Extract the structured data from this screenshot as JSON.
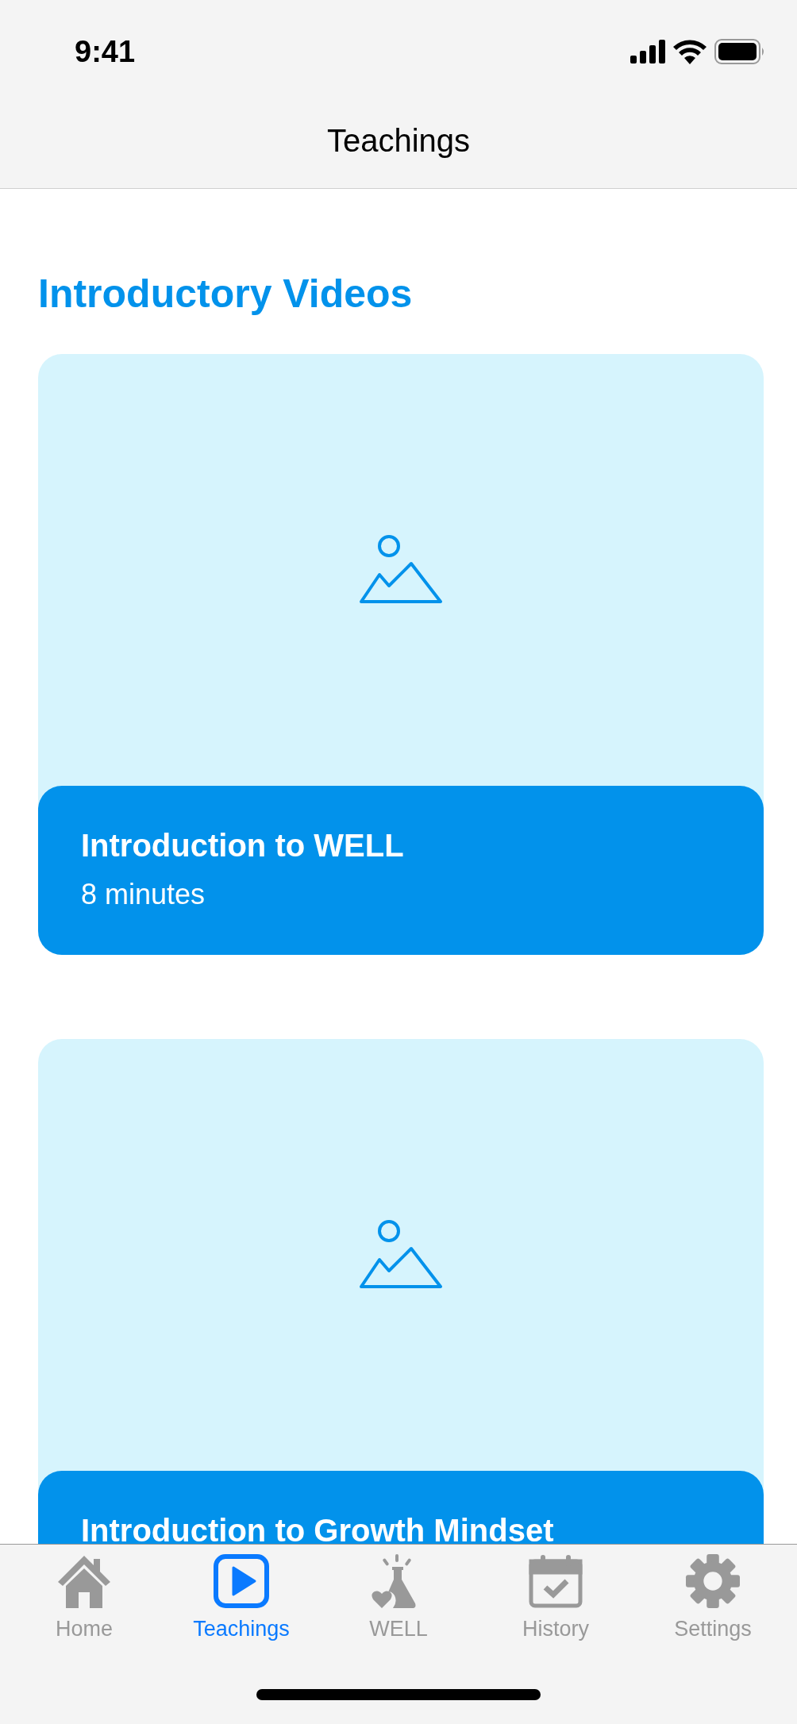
{
  "status_bar": {
    "time": "9:41"
  },
  "nav_bar": {
    "title": "Teachings"
  },
  "section": {
    "title": "Introductory Videos"
  },
  "videos": [
    {
      "title": "Introduction to WELL",
      "duration": "8 minutes"
    },
    {
      "title": "Introduction to Growth Mindset"
    }
  ],
  "tab_bar": [
    {
      "label": "Home",
      "selected": false
    },
    {
      "label": "Teachings",
      "selected": true
    },
    {
      "label": "WELL",
      "selected": false
    },
    {
      "label": "History",
      "selected": false
    },
    {
      "label": "Settings",
      "selected": false
    }
  ]
}
